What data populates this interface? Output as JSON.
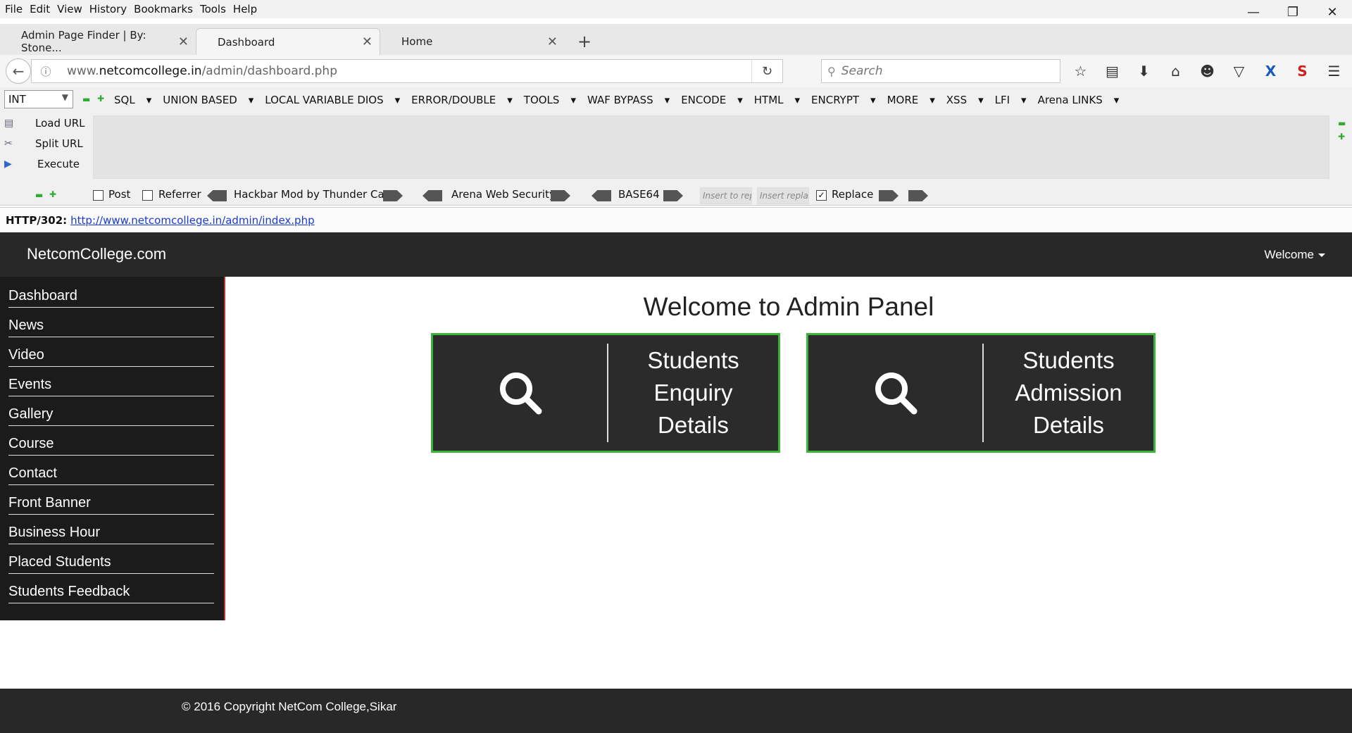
{
  "menubar": {
    "items": [
      "File",
      "Edit",
      "View",
      "History",
      "Bookmarks",
      "Tools",
      "Help"
    ]
  },
  "tabs": [
    {
      "label": "Admin Page Finder | By: Stone..."
    },
    {
      "label": "Dashboard"
    },
    {
      "label": "Home"
    }
  ],
  "nav": {
    "url_prefix": "www.",
    "url_domain": "netcomcollege.in",
    "url_path": "/admin/dashboard.php",
    "search_placeholder": "Search"
  },
  "hackbar": {
    "select_value": "INT",
    "menus": [
      "SQL",
      "UNION BASED",
      "LOCAL VARIABLE DIOS",
      "ERROR/DOUBLE",
      "TOOLS",
      "WAF BYPASS",
      "ENCODE",
      "HTML",
      "ENCRYPT",
      "MORE",
      "XSS",
      "LFI",
      "Arena LINKS"
    ],
    "load_url": "Load URL",
    "split_url": "Split URL",
    "execute": "Execute",
    "post_label": "Post",
    "referrer_label": "Referrer",
    "mod_label": "Hackbar Mod by Thunder Cats",
    "arena_label": "Arena Web Security",
    "base64_label": "BASE64",
    "insert_placeholder": "Insert to rep",
    "replace_placeholder": "Insert replac",
    "replace_label": "Replace"
  },
  "status": {
    "code": "HTTP/302:",
    "link": "http://www.netcomcollege.in/admin/index.php"
  },
  "site": {
    "brand": "NetcomCollege.com",
    "welcome": "Welcome",
    "sidebar": [
      "Dashboard",
      "News",
      "Video",
      "Events",
      "Gallery",
      "Course",
      "Contact",
      "Front Banner",
      "Business Hour",
      "Placed Students",
      "Students Feedback"
    ],
    "title": "Welcome to Admin Panel",
    "cards": [
      {
        "line1": "Students",
        "line2": "Enquiry",
        "line3": "Details"
      },
      {
        "line1": "Students",
        "line2": "Admission",
        "line3": "Details"
      }
    ],
    "footer": "© 2016 Copyright NetCom College,Sikar",
    "card_border_color": "#3bb33b"
  }
}
